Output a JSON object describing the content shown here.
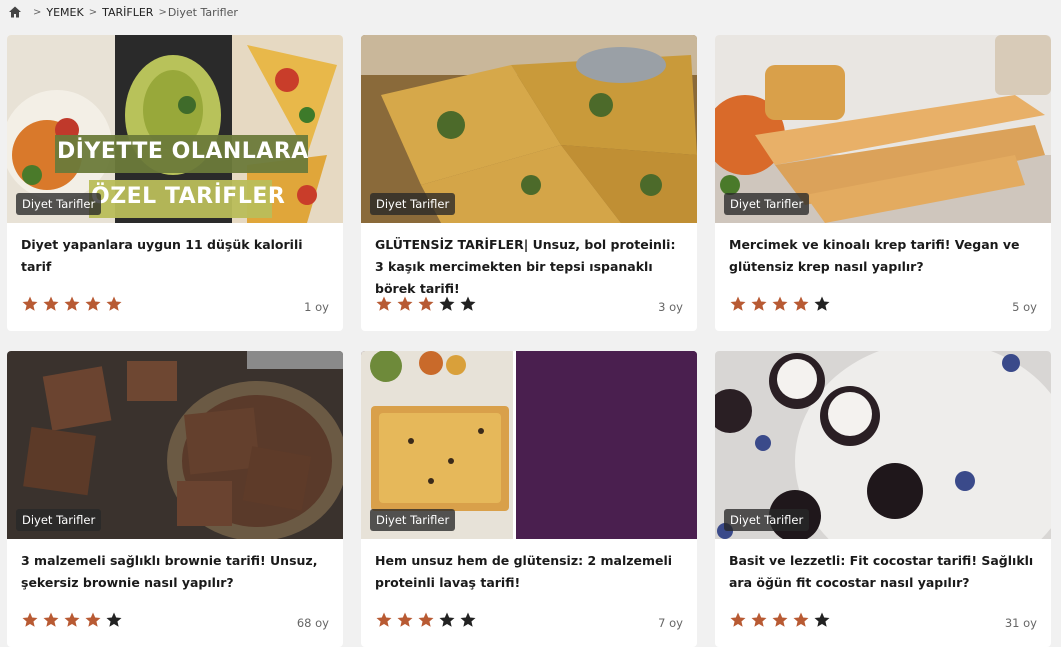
{
  "breadcrumb": {
    "home_icon": "home-icon",
    "items": [
      "YEMEK",
      "TARİFLER"
    ],
    "current": "Diyet Tarifler"
  },
  "colors": {
    "star_on": "#b85a33",
    "star_off": "#222222"
  },
  "cards": [
    {
      "category": "Diyet Tarifler",
      "title": "Diyet yapanlara uygun 11 düşük kalorili tarif",
      "rating": 5,
      "age": "1 oy",
      "overlay_line1": "DİYETTE OLANLARA",
      "overlay_line2": "ÖZEL TARİFLER"
    },
    {
      "category": "Diyet Tarifler",
      "title": "GLÜTENSİZ TARİFLER| Unsuz, bol proteinli: 3 kaşık mercimekten bir tepsi ıspanaklı börek tarifi!",
      "rating": 3,
      "age": "3 oy"
    },
    {
      "category": "Diyet Tarifler",
      "title": "Mercimek ve kinoalı krep tarifi! Vegan ve glütensiz krep nasıl yapılır?",
      "rating": 4,
      "age": "5 oy"
    },
    {
      "category": "Diyet Tarifler",
      "title": "3 malzemeli sağlıklı brownie tarifi! Unsuz, şekersiz brownie nasıl yapılır?",
      "rating": 4,
      "age": "68 oy"
    },
    {
      "category": "Diyet Tarifler",
      "title": "Hem unsuz hem de glütensiz: 2 malzemeli proteinli lavaş tarifi!",
      "rating": 3,
      "age": "7 oy"
    },
    {
      "category": "Diyet Tarifler",
      "title": "Basit ve lezzetli: Fit cocostar tarifi! Sağlıklı ara öğün fit cocostar nasıl yapılır?",
      "rating": 4,
      "age": "31 oy"
    }
  ]
}
